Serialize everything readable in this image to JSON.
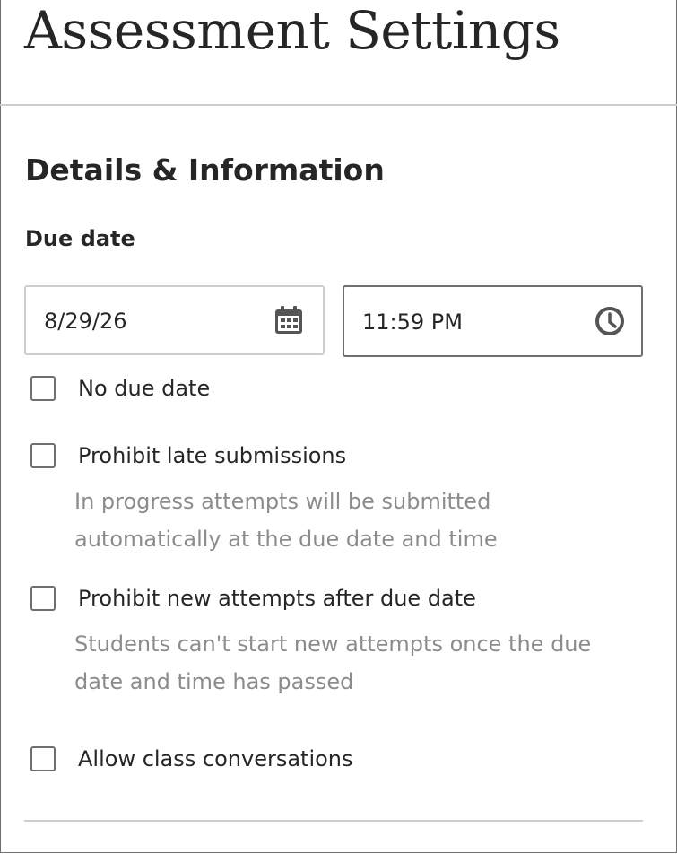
{
  "page": {
    "title": "Assessment Settings"
  },
  "section": {
    "title": "Details & Information",
    "due_date": {
      "label": "Due date",
      "date_value": "8/29/26",
      "date_icon": "calendar-icon",
      "time_value": "11:59 PM",
      "time_icon": "clock-icon"
    },
    "options": [
      {
        "label": "No due date",
        "checked": false
      },
      {
        "label": "Prohibit late submissions",
        "checked": false,
        "help": [
          "In progress attempts will be submitted",
          "automatically at the due date and time"
        ]
      },
      {
        "label": "Prohibit new attempts after due date",
        "checked": false,
        "help": [
          "Students can't start new attempts once the due",
          "date and time has passed"
        ]
      },
      {
        "label": "Allow class conversations",
        "checked": false
      }
    ]
  },
  "colors": {
    "text": "#262626",
    "muted": "#8c8c8c",
    "border": "#6f6f6f",
    "divider": "#cdcdcd"
  }
}
